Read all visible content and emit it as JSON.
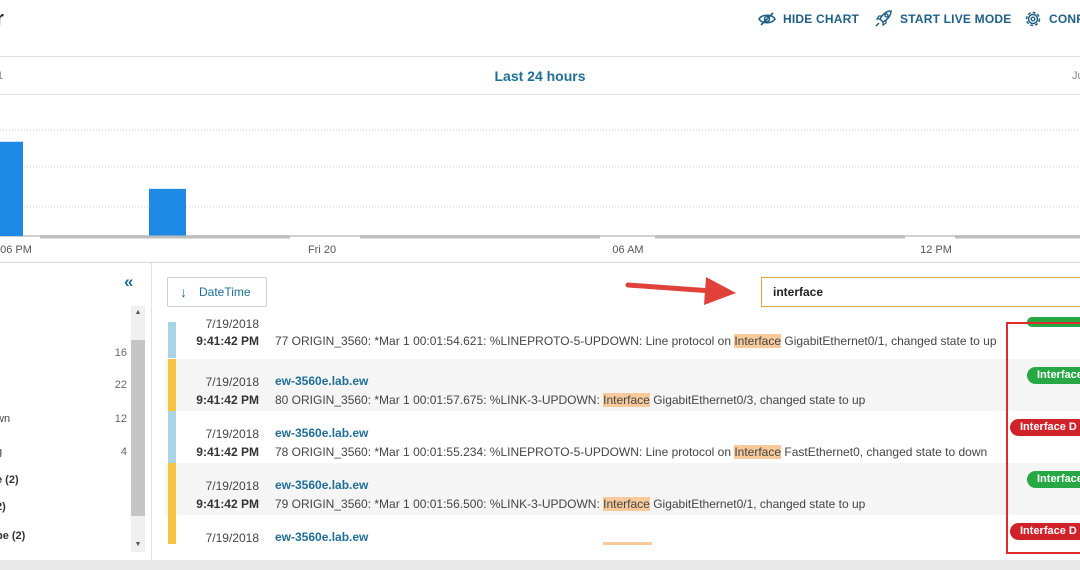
{
  "header": {
    "title": "r",
    "hide_chart": "HIDE CHART",
    "start_live": "START LIVE MODE",
    "config": "CONF"
  },
  "range": {
    "title": "Last 24 hours",
    "left_label": "1",
    "right_label": "Ju"
  },
  "chart_data": {
    "type": "bar",
    "x_tick_labels": [
      "06 PM",
      "Fri 20",
      "06 AM",
      "12 PM"
    ],
    "bars": [
      {
        "label": "06 PM bucket",
        "value": 4
      },
      {
        "label": "Fri 20 bucket",
        "value": 2
      }
    ],
    "grid": true,
    "colors": {
      "bar": "#1e88e5"
    }
  },
  "facets": [
    {
      "label": "",
      "count": "16"
    },
    {
      "label": "",
      "count": "22"
    },
    {
      "label": "wn",
      "count": "12"
    },
    {
      "label": "g",
      "count": "4"
    },
    {
      "label": "e (2)",
      "count": ""
    },
    {
      "label": "2)",
      "count": ""
    },
    {
      "label": "pe (2)",
      "count": ""
    }
  ],
  "controls": {
    "sort_label": "DateTime",
    "search_value": "interface"
  },
  "rows": [
    {
      "date": "7/19/2018",
      "time": "9:41:42 PM",
      "host": "",
      "msg_pre": "77 ORIGIN_3560: *Mar 1 00:01:54.621: %LINEPROTO-5-UPDOWN: Line protocol on ",
      "msg_hl": "Interface",
      "msg_post": " GigabitEthernet0/1, changed state to up",
      "tag": "",
      "tag_color": "green",
      "sev_color": "#a8d4e6"
    },
    {
      "date": "7/19/2018",
      "time": "9:41:42 PM",
      "host": "ew-3560e.lab.ew",
      "msg_pre": "80 ORIGIN_3560: *Mar 1 00:01:57.675: %LINK-3-UPDOWN: ",
      "msg_hl": "Interface",
      "msg_post": " GigabitEthernet0/3, changed state to up",
      "tag": "Interface",
      "tag_color": "green",
      "sev_color": "#f6c343"
    },
    {
      "date": "7/19/2018",
      "time": "9:41:42 PM",
      "host": "ew-3560e.lab.ew",
      "msg_pre": "78 ORIGIN_3560: *Mar 1 00:01:55.234: %LINEPROTO-5-UPDOWN: Line protocol on ",
      "msg_hl": "Interface",
      "msg_post": " FastEthernet0, changed state to down",
      "tag": "Interface D",
      "tag_color": "red",
      "sev_color": "#a8d4e6"
    },
    {
      "date": "7/19/2018",
      "time": "9:41:42 PM",
      "host": "ew-3560e.lab.ew",
      "msg_pre": "79 ORIGIN_3560: *Mar 1 00:01:56.500: %LINK-3-UPDOWN: ",
      "msg_hl": "Interface",
      "msg_post": " GigabitEthernet0/1, changed state to up",
      "tag": "Interface",
      "tag_color": "green",
      "sev_color": "#f6c343"
    },
    {
      "date": "7/19/2018",
      "time": "",
      "host": "ew-3560e.lab.ew",
      "msg_pre": "",
      "msg_hl": "",
      "msg_post": "",
      "tag": "Interface D",
      "tag_color": "red",
      "sev_color": "#f6c343"
    }
  ]
}
